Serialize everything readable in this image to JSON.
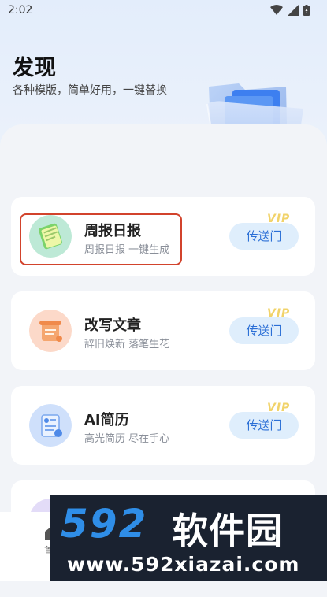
{
  "status_bar": {
    "time": "2:02"
  },
  "header": {
    "title": "发现",
    "subtitle": "各种模版，简单好用，一键替换"
  },
  "cards": [
    {
      "name": "周报日报",
      "desc": "周报日报 一键生成",
      "button": "传送门",
      "badge": "VIP",
      "icon": "notepad-icon"
    },
    {
      "name": "改写文章",
      "desc": "辞旧焕新 落笔生花",
      "button": "传送门",
      "badge": "VIP",
      "icon": "scroll-icon"
    },
    {
      "name": "AI简历",
      "desc": "高光简历 尽在手心",
      "button": "传送门",
      "badge": "VIP",
      "icon": "resume-icon"
    }
  ],
  "bottom_tab": {
    "label": "首"
  },
  "watermark": {
    "number": "592",
    "text": "软件园",
    "url": "www.592xiazai.com"
  },
  "colors": {
    "accent": "#2b6fd6",
    "button_bg": "#dfeefc",
    "vip": "#f1d36a",
    "highlight": "#d2432c"
  }
}
